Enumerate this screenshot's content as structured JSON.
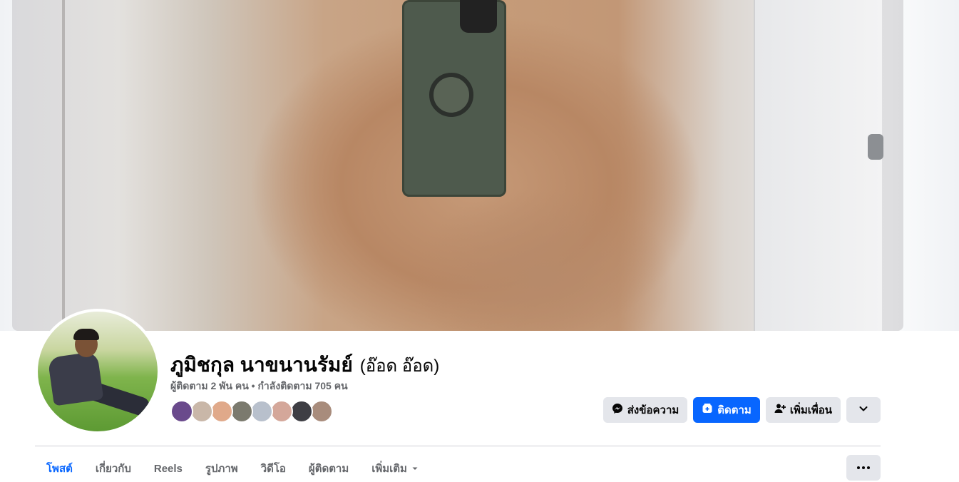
{
  "profile": {
    "name": "ภูมิชกุล นาขนานรัมย์",
    "nickname": "(อ๊อด อ๊อด)",
    "stats": "ผู้ติดตาม 2 พัน คน • กำลังติดตาม 705 คน"
  },
  "friends": [
    {
      "color": "#6a4a8c"
    },
    {
      "color": "#c9b7a8"
    },
    {
      "color": "#e0a98a"
    },
    {
      "color": "#7b7a6e"
    },
    {
      "color": "#b8c0cc"
    },
    {
      "color": "#d4a79a"
    },
    {
      "color": "#3e3e44"
    },
    {
      "color": "#a88c7c"
    }
  ],
  "actions": {
    "message_label": "ส่งข้อความ",
    "follow_label": "ติดตาม",
    "add_friend_label": "เพิ่มเพื่อน",
    "message_icon": "messenger-icon",
    "follow_icon": "follow-icon",
    "add_friend_icon": "add-friend-icon",
    "dropdown_icon": "chevron-down-icon"
  },
  "tabs": [
    {
      "label": "โพสต์",
      "active": true
    },
    {
      "label": "เกี่ยวกับ",
      "active": false
    },
    {
      "label": "Reels",
      "active": false
    },
    {
      "label": "รูปภาพ",
      "active": false
    },
    {
      "label": "วิดีโอ",
      "active": false
    },
    {
      "label": "ผู้ติดตาม",
      "active": false
    },
    {
      "label": "เพิ่มเติม",
      "active": false,
      "icon": "caret-down-icon"
    }
  ],
  "colors": {
    "accent": "#0866ff",
    "button_grey": "#e4e6eb",
    "secondary_text": "#65676b"
  }
}
